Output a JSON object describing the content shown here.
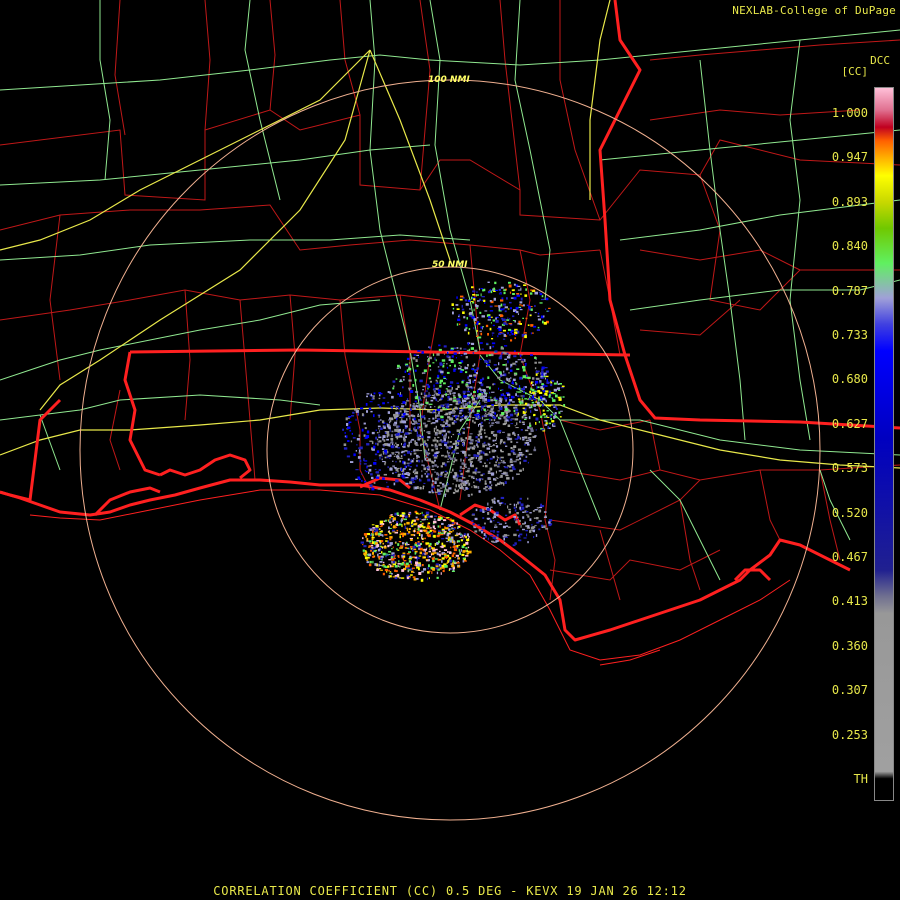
{
  "header": {
    "credit": "NEXLAB-College of DuPage",
    "product_code": "DCC",
    "units": "[CC]"
  },
  "footer": {
    "caption": "CORRELATION COEFFICIENT (CC) 0.5 DEG - KEVX 19 JAN 26 12:12"
  },
  "range_rings": [
    {
      "label": "50 NMI",
      "nmi": 50
    },
    {
      "label": "100 NMI",
      "nmi": 100
    }
  ],
  "legend": {
    "ticks": [
      "1.000",
      "0.947",
      "0.893",
      "0.840",
      "0.787",
      "0.733",
      "0.680",
      "0.627",
      "0.573",
      "0.520",
      "0.467",
      "0.413",
      "0.360",
      "0.307",
      "0.253",
      "TH"
    ],
    "colors": {
      "state_border": "#ff2020",
      "county_border": "#c01818",
      "highway": "#90e890",
      "interstate": "#e8e84a",
      "range_ring": "#f0b090"
    },
    "scale": [
      {
        "v": 1.0,
        "c": "#ffc0d8"
      },
      {
        "v": 0.975,
        "c": "#e07090"
      },
      {
        "v": 0.955,
        "c": "#c00020"
      },
      {
        "v": 0.94,
        "c": "#ff6000"
      },
      {
        "v": 0.92,
        "c": "#ffb000"
      },
      {
        "v": 0.9,
        "c": "#ffff00"
      },
      {
        "v": 0.87,
        "c": "#c8d800"
      },
      {
        "v": 0.84,
        "c": "#70c800"
      },
      {
        "v": 0.8,
        "c": "#60f060"
      },
      {
        "v": 0.76,
        "c": "#a0a0d8"
      },
      {
        "v": 0.73,
        "c": "#4040e0"
      },
      {
        "v": 0.7,
        "c": "#0000ff"
      },
      {
        "v": 0.6,
        "c": "#0000c0"
      },
      {
        "v": 0.45,
        "c": "#202090"
      },
      {
        "v": 0.42,
        "c": "#707090"
      },
      {
        "v": 0.4,
        "c": "#989898"
      },
      {
        "v": 0.22,
        "c": "#a0a0a0"
      }
    ]
  }
}
